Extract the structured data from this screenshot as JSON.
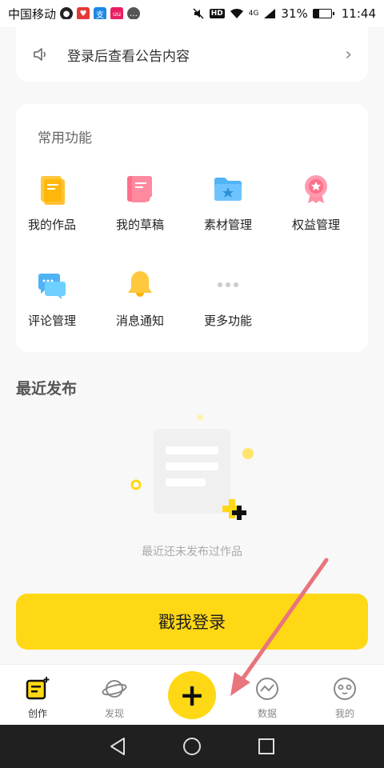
{
  "status_bar": {
    "carrier": "中国移动",
    "network": "4G",
    "hd": "HD",
    "battery_percent": "31%",
    "battery_level": 0.31,
    "time": "11:44"
  },
  "notice": {
    "text": "登录后查看公告内容",
    "icon": "speaker-icon"
  },
  "functions": {
    "title": "常用功能",
    "items": [
      {
        "label": "我的作品",
        "icon": "works-icon"
      },
      {
        "label": "我的草稿",
        "icon": "drafts-icon"
      },
      {
        "label": "素材管理",
        "icon": "folder-icon"
      },
      {
        "label": "权益管理",
        "icon": "badge-icon"
      },
      {
        "label": "评论管理",
        "icon": "comment-icon"
      },
      {
        "label": "消息通知",
        "icon": "bell-icon"
      },
      {
        "label": "更多功能",
        "icon": "more-icon"
      }
    ]
  },
  "recent": {
    "title": "最近发布",
    "empty_text": "最近还未发布过作品"
  },
  "login_button": "戳我登录",
  "tabs": [
    {
      "label": "创作",
      "icon": "create-icon",
      "active": true
    },
    {
      "label": "发现",
      "icon": "planet-icon",
      "active": false
    },
    {
      "label": "",
      "icon": "plus-icon",
      "active": false
    },
    {
      "label": "数据",
      "icon": "data-icon",
      "active": false
    },
    {
      "label": "我的",
      "icon": "penguin-icon",
      "active": false
    }
  ],
  "colors": {
    "accent": "#ffd815",
    "annotation_arrow": "#e8747c"
  }
}
